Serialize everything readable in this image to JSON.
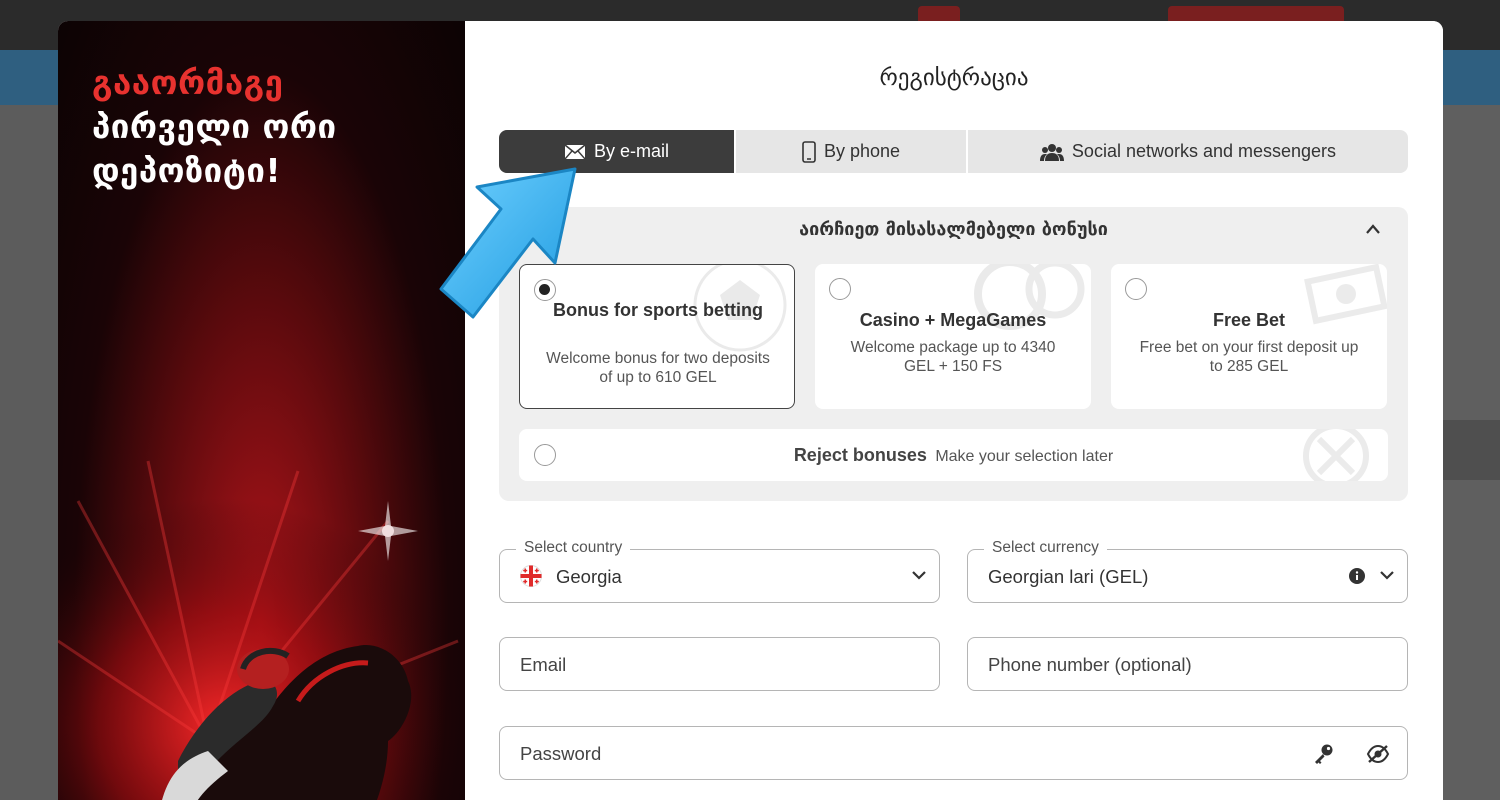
{
  "promo": {
    "line1": "გააორმაგე",
    "line2": "პირველი ორი",
    "line3": "დეპოზიტი!"
  },
  "modal": {
    "title": "რეგისტრაცია"
  },
  "tabs": [
    {
      "label": "By e-mail",
      "icon": "envelope-icon",
      "active": true
    },
    {
      "label": "By phone",
      "icon": "phone-icon",
      "active": false
    },
    {
      "label": "Social networks and messengers",
      "icon": "users-icon",
      "active": false
    }
  ],
  "bonus": {
    "title": "აირჩიეთ მისასალმებელი ბონუსი",
    "options": [
      {
        "name": "Bonus for sports betting",
        "description": "Welcome bonus for two deposits of up to 610 GEL",
        "selected": true
      },
      {
        "name": "Casino + MegaGames",
        "description": "Welcome package up to 4340 GEL + 150 FS",
        "selected": false
      },
      {
        "name": "Free Bet",
        "description": "Free bet on your first deposit up to 285 GEL",
        "selected": false
      }
    ],
    "reject": {
      "label": "Reject bonuses",
      "note": "Make your selection later",
      "selected": false
    }
  },
  "fields": {
    "country": {
      "label": "Select country",
      "value": "Georgia"
    },
    "currency": {
      "label": "Select currency",
      "value": "Georgian lari (GEL)"
    },
    "email": {
      "placeholder": "Email"
    },
    "phone": {
      "placeholder": "Phone number (optional)"
    },
    "password": {
      "placeholder": "Password"
    }
  },
  "colors": {
    "accent_red": "#e8322f",
    "active_tab": "#3c3c3c",
    "arrow_blue": "#3fb4f0"
  }
}
